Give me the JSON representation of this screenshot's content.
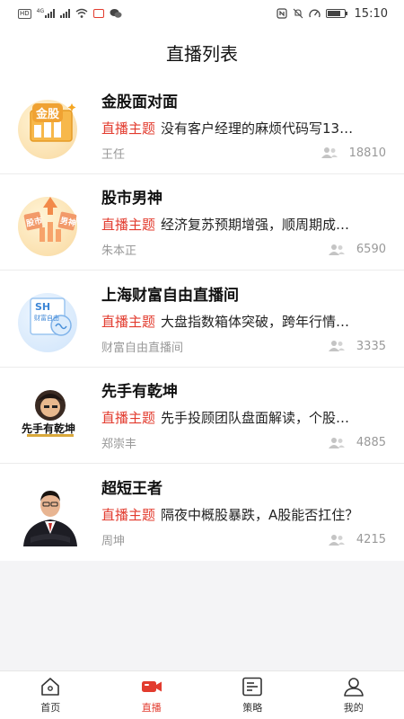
{
  "status_bar": {
    "left_icons": [
      "hd-icon",
      "4g-signal-icon",
      "signal-icon",
      "wifi-icon",
      "red-app-icon",
      "wechat-icon"
    ],
    "right_icons": [
      "nfc-icon",
      "mute-icon",
      "speed-icon",
      "battery-icon"
    ],
    "time": "15:10",
    "hd": "HD",
    "net": "4G"
  },
  "header": {
    "title": "直播列表"
  },
  "topic_tag": "直播主题",
  "rooms": [
    {
      "title": "金股面对面",
      "topic": "没有客户经理的麻烦代码写13…",
      "host": "王任",
      "viewers": "18810",
      "thumb": "gold-stocks"
    },
    {
      "title": "股市男神",
      "topic": "经济复苏预期增强，顺周期成…",
      "host": "朱本正",
      "viewers": "6590",
      "thumb": "stock-god"
    },
    {
      "title": "上海财富自由直播间",
      "topic": "大盘指数箱体突破，跨年行情…",
      "host": "财富自由直播间",
      "viewers": "3335",
      "thumb": "sh-freedom"
    },
    {
      "title": "先手有乾坤",
      "topic": "先手投顾团队盘面解读，个股…",
      "host": "郑崇丰",
      "viewers": "4885",
      "thumb": "xianshou-logo"
    },
    {
      "title": "超短王者",
      "topic": "隔夜中概股暴跌，A股能否扛住？",
      "host": "周坤",
      "viewers": "4215",
      "thumb": "host-portrait"
    }
  ],
  "thumb_text": {
    "gold": "金股",
    "stock_god_left": "股市",
    "stock_god_right": "男神",
    "sh_big": "SH",
    "sh_small": "财富自由",
    "xianshou": "先手有乾坤"
  },
  "tabs": [
    {
      "label": "首页",
      "icon": "home-icon",
      "active": false
    },
    {
      "label": "直播",
      "icon": "live-camera-icon",
      "active": true
    },
    {
      "label": "策略",
      "icon": "strategy-doc-icon",
      "active": false
    },
    {
      "label": "我的",
      "icon": "profile-icon",
      "active": false
    }
  ],
  "colors": {
    "accent": "#e23b2e",
    "text": "#222222",
    "muted": "#999999",
    "bg": "#f4f4f6"
  }
}
